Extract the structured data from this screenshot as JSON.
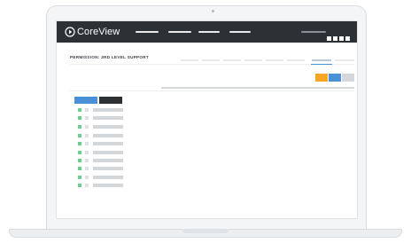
{
  "app": {
    "brand_name": "CoreView",
    "colors": {
      "header_bg": "#2c3136",
      "accent_blue": "#4a90d9",
      "accent_orange": "#f5a623",
      "success_green": "#6ccf8e"
    }
  },
  "header": {
    "logo_icon": "play-circle-icon",
    "nav_items": [
      {
        "name": "nav-item-1"
      },
      {
        "name": "nav-item-2"
      },
      {
        "name": "nav-item-3"
      },
      {
        "name": "nav-item-4"
      }
    ],
    "user_label_icon": "user-placeholder",
    "window_controls": [
      "square-icon",
      "square-icon",
      "square-icon",
      "square-icon"
    ]
  },
  "page": {
    "title": "PERMISSION: 3RD LEVEL SUPPORT",
    "tabs": [
      {
        "active": false
      },
      {
        "active": false
      },
      {
        "active": false
      },
      {
        "active": false
      },
      {
        "active": false
      },
      {
        "active": false
      },
      {
        "active": false
      },
      {
        "active": true
      },
      {
        "active": false
      }
    ],
    "actions": [
      {
        "name": "orange-action-button",
        "color": "#f5a623"
      },
      {
        "name": "blue-action-button",
        "color": "#4a90d9"
      },
      {
        "name": "gray-action-button",
        "color": "#d4d7da"
      }
    ]
  },
  "list": {
    "header_buttons": [
      {
        "name": "blue-filter-button",
        "color": "#4a90d9"
      },
      {
        "name": "dark-filter-button",
        "color": "#2c3136"
      }
    ],
    "rows": [
      {
        "checked": true
      },
      {
        "checked": true
      },
      {
        "checked": true
      },
      {
        "checked": true
      },
      {
        "checked": true
      },
      {
        "checked": true
      },
      {
        "checked": true
      },
      {
        "checked": true
      },
      {
        "checked": true
      },
      {
        "checked": true
      }
    ]
  }
}
